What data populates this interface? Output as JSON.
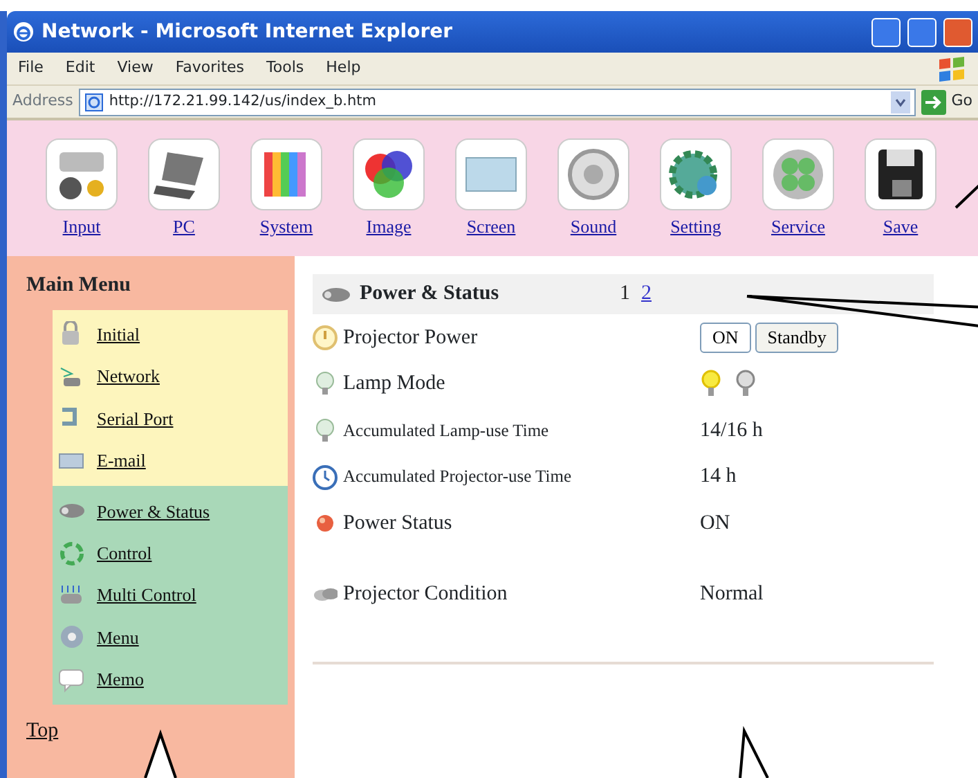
{
  "window": {
    "title": "Network - Microsoft Internet Explorer"
  },
  "menu_bar": [
    "File",
    "Edit",
    "View",
    "Favorites",
    "Tools",
    "Help"
  ],
  "address_bar": {
    "label": "Address",
    "value": "http://172.21.99.142/us/index_b.htm",
    "go": "Go"
  },
  "toolbar": [
    {
      "label": "Input",
      "kind": "input"
    },
    {
      "label": "PC",
      "kind": "pc"
    },
    {
      "label": "System",
      "kind": "system"
    },
    {
      "label": "Image",
      "kind": "image"
    },
    {
      "label": "Screen",
      "kind": "screen"
    },
    {
      "label": "Sound",
      "kind": "sound"
    },
    {
      "label": "Setting",
      "kind": "setting"
    },
    {
      "label": "Service",
      "kind": "service"
    },
    {
      "label": "Save",
      "kind": "save"
    }
  ],
  "sidebar": {
    "title": "Main Menu",
    "groups": [
      {
        "color": "#fdf5bd",
        "items": [
          {
            "label": "Initial",
            "kind": "lock"
          },
          {
            "label": "Network",
            "kind": "network"
          },
          {
            "label": "Serial Port",
            "kind": "serial"
          },
          {
            "label": "E-mail",
            "kind": "mail"
          }
        ]
      },
      {
        "color": "#a9d8b8",
        "items": [
          {
            "label": "Power & Status",
            "kind": "projector"
          },
          {
            "label": "Control",
            "kind": "control"
          },
          {
            "label": "Multi Control",
            "kind": "multi"
          },
          {
            "label": "Menu",
            "kind": "menu"
          },
          {
            "label": "Memo",
            "kind": "memo"
          }
        ]
      }
    ],
    "top_link": "Top"
  },
  "content": {
    "title": "Power & Status",
    "pages": [
      {
        "label": "1",
        "selected": true
      },
      {
        "label": "2",
        "selected": false
      }
    ],
    "rows": [
      {
        "label": "Projector Power",
        "kind": "buttons",
        "buttons": [
          {
            "label": "ON",
            "selected": true
          },
          {
            "label": "Standby",
            "selected": false
          }
        ]
      },
      {
        "label": "Lamp Mode",
        "kind": "lamps",
        "lamps": [
          {
            "on": true
          },
          {
            "on": false
          }
        ]
      },
      {
        "label": "Accumulated Lamp-use Time",
        "kind": "text",
        "value": "14/16 h"
      },
      {
        "label": "Accumulated Projector-use Time",
        "kind": "text",
        "value": "14 h"
      },
      {
        "label": "Power Status",
        "kind": "text",
        "value": "ON"
      },
      {
        "label": "Projector Condition",
        "kind": "text",
        "value": "Normal"
      }
    ]
  }
}
